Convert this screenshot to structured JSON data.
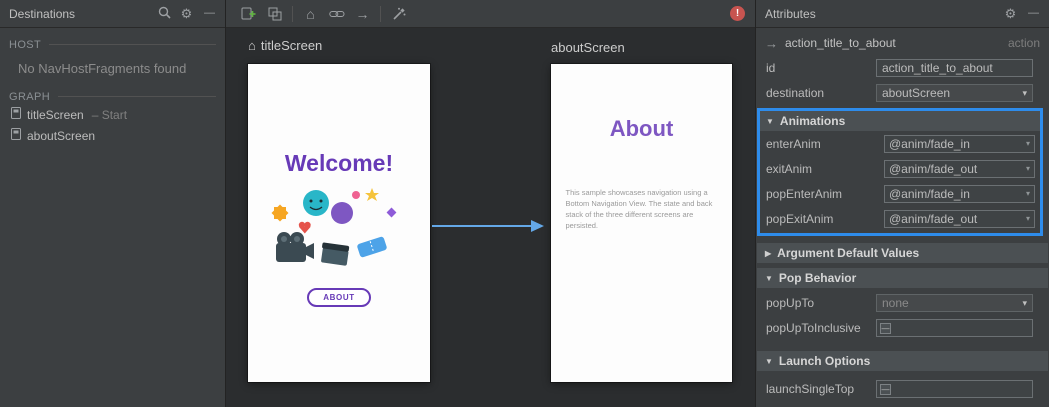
{
  "icons": {
    "gear": "⚙",
    "minimize": "—",
    "home": "⌂",
    "action_arrow": "→",
    "expand": "▼",
    "collapse": "▶",
    "dropdown": "▾",
    "indeterminate": "—",
    "error_mark": "!"
  },
  "colors": {
    "highlight_blue": "#2e8ceb",
    "arrow_blue": "#64a8e8",
    "brand_purple": "#673ab7",
    "error_red": "#c75450"
  },
  "destinations_panel": {
    "title": "Destinations",
    "host_label": "HOST",
    "host_empty_text": "No NavHostFragments found",
    "graph_label": "GRAPH",
    "items": [
      {
        "label": "titleScreen",
        "suffix": "– Start"
      },
      {
        "label": "aboutScreen",
        "suffix": ""
      }
    ]
  },
  "canvas": {
    "title_screen": {
      "label": "titleScreen",
      "heading": "Welcome!",
      "button_label": "ABOUT"
    },
    "about_screen": {
      "label": "aboutScreen",
      "heading": "About",
      "body": "This sample showcases navigation using a Bottom Navigation View. The state and back stack of the three different screens are persisted."
    }
  },
  "attributes_panel": {
    "title": "Attributes",
    "action": {
      "name": "action_title_to_about",
      "type": "action"
    },
    "id_label": "id",
    "id_value": "action_title_to_about",
    "destination_label": "destination",
    "destination_value": "aboutScreen",
    "animations": {
      "header": "Animations",
      "rows": [
        {
          "label": "enterAnim",
          "value": "@anim/fade_in"
        },
        {
          "label": "exitAnim",
          "value": "@anim/fade_out"
        },
        {
          "label": "popEnterAnim",
          "value": "@anim/fade_in"
        },
        {
          "label": "popExitAnim",
          "value": "@anim/fade_out"
        }
      ]
    },
    "argument_defaults_header": "Argument Default Values",
    "pop_behavior": {
      "header": "Pop Behavior",
      "pop_up_to_label": "popUpTo",
      "pop_up_to_value": "none",
      "pop_up_to_inclusive_label": "popUpToInclusive"
    },
    "launch_options": {
      "header": "Launch Options",
      "launch_single_top_label": "launchSingleTop"
    }
  }
}
